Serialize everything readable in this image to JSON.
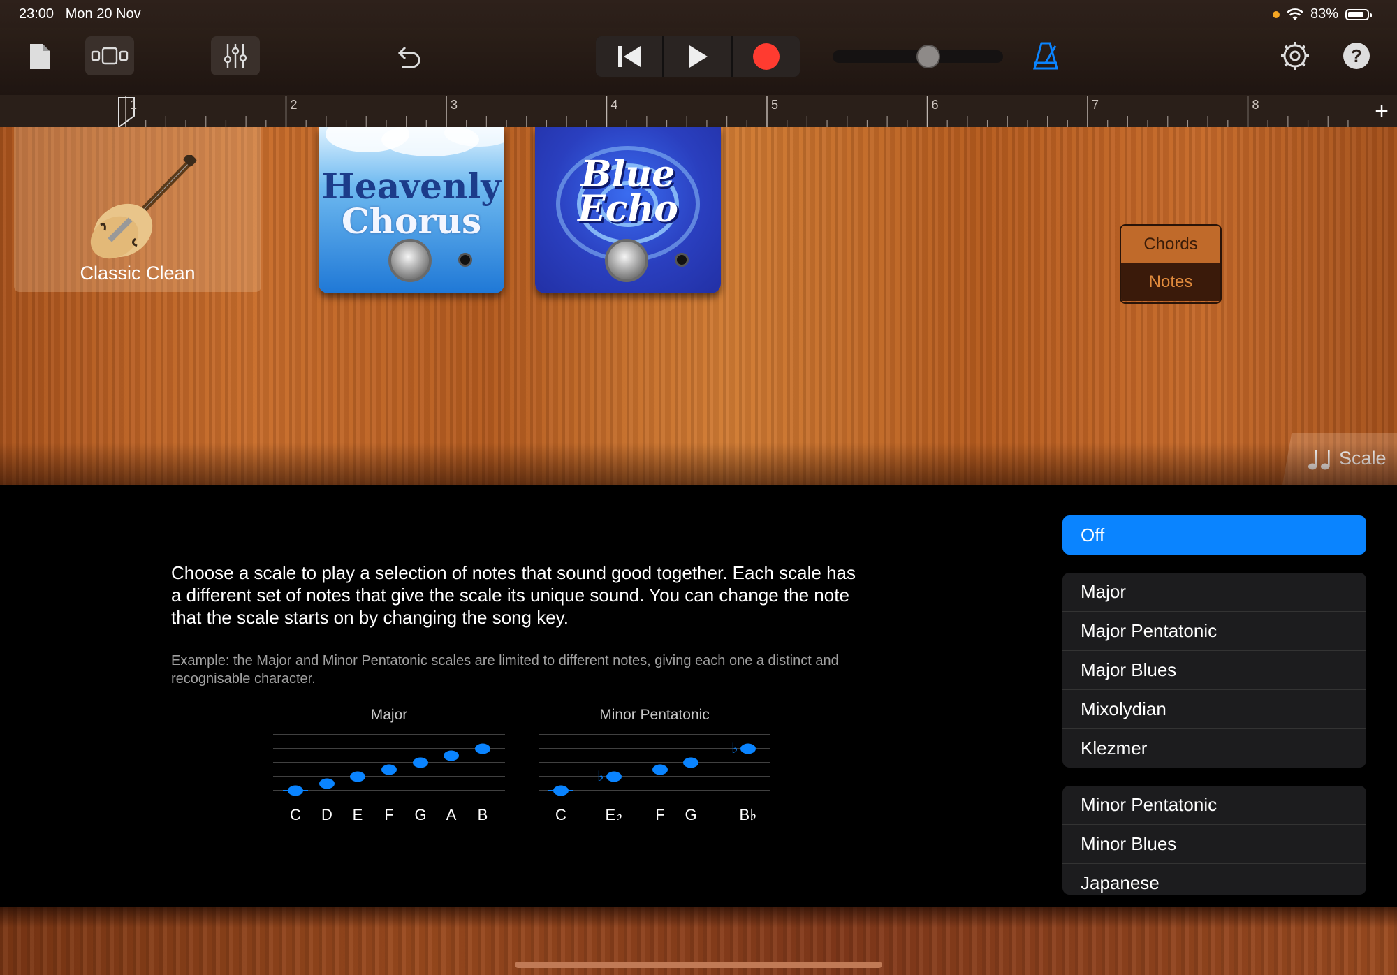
{
  "status_bar": {
    "time": "23:00",
    "date": "Mon 20 Nov",
    "battery": "83%",
    "battery_level": 0.83
  },
  "toolbar": {
    "buttons": [
      {
        "name": "my-songs-button",
        "icon": "document-icon"
      },
      {
        "name": "view-toggle-button",
        "icon": "tracks-view-icon"
      },
      {
        "name": "mixer-button",
        "icon": "sliders-icon"
      },
      {
        "name": "undo-button",
        "icon": "undo-icon"
      },
      {
        "name": "rewind-button",
        "icon": "skip-back-icon"
      },
      {
        "name": "play-button",
        "icon": "play-icon"
      },
      {
        "name": "record-button",
        "icon": "record-icon"
      },
      {
        "name": "metronome-button",
        "icon": "metronome-icon"
      },
      {
        "name": "settings-button",
        "icon": "gear-icon"
      },
      {
        "name": "help-button",
        "icon": "question-icon"
      }
    ],
    "master_volume": 0.57,
    "accent_blue": "#0a84ff",
    "record_red": "#ff3b30"
  },
  "ruler": {
    "bars": [
      "1",
      "2",
      "3",
      "4",
      "5",
      "6",
      "7",
      "8"
    ],
    "add_label": "+"
  },
  "amp": {
    "name": "Classic Clean",
    "icon": "guitar-icon"
  },
  "pedals": [
    {
      "line1": "Heavenly",
      "line2": "Chorus"
    },
    {
      "line1": "Blue",
      "line2": "Echo"
    }
  ],
  "mode_toggle": {
    "chords": "Chords",
    "notes": "Notes",
    "selected": "Chords"
  },
  "scale_tab": {
    "label": "Scale",
    "icon": "music-notes-icon"
  },
  "scale_panel": {
    "description": "Choose a scale to play a selection of notes that sound good together. Each scale has a different set of notes that give the scale its unique sound. You can change the note that the scale starts on by changing the song key.",
    "example": "Example: the Major and Minor Pentatonic scales are limited to different notes, giving each one a distinct and recognisable character.",
    "staffs": [
      {
        "title": "Major",
        "notes": [
          "C",
          "D",
          "E",
          "F",
          "G",
          "A",
          "B"
        ]
      },
      {
        "title": "Minor Pentatonic",
        "notes": [
          "C",
          "E♭",
          "F",
          "G",
          "B♭"
        ]
      }
    ],
    "note_color": "#0a84ff"
  },
  "scale_list": {
    "off": "Off",
    "group1": [
      "Major",
      "Major Pentatonic",
      "Major Blues",
      "Mixolydian",
      "Klezmer"
    ],
    "group2": [
      "Minor Pentatonic",
      "Minor Blues",
      "Japanese"
    ]
  }
}
